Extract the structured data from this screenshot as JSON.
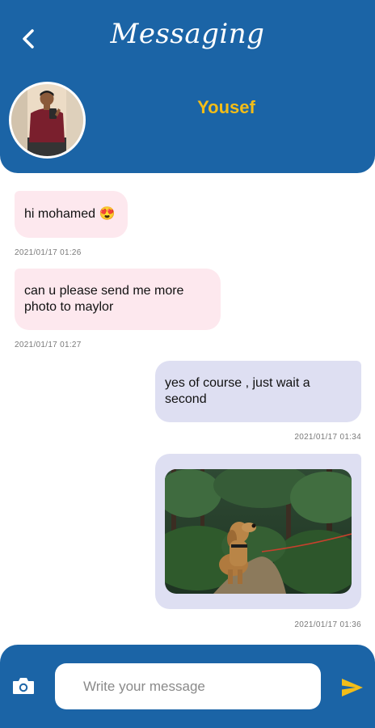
{
  "header": {
    "title": "Messaging",
    "contact_name": "Yousef",
    "back_icon": "chevron-left-icon",
    "avatar_icon": "user-avatar-photo"
  },
  "messages": [
    {
      "direction": "incoming",
      "text": "hi mohamed 😍",
      "time": "2021/01/17  01:26"
    },
    {
      "direction": "incoming",
      "text": "can u please send me more photo to maylor",
      "time": "2021/01/17  01:27"
    },
    {
      "direction": "outgoing",
      "text": "yes of course , just wait a second",
      "time": "2021/01/17  01:34"
    },
    {
      "direction": "outgoing",
      "type": "image",
      "image": "dog-on-forest-path-photo",
      "time": "2021/01/17  01:36"
    }
  ],
  "input_bar": {
    "placeholder": "Write your message",
    "value": "",
    "camera_icon": "camera-icon",
    "send_icon": "send-icon"
  },
  "colors": {
    "primary": "#1b64a6",
    "accent": "#f3bd18",
    "incoming_bubble": "#fde8ee",
    "outgoing_bubble": "#dedff2"
  }
}
